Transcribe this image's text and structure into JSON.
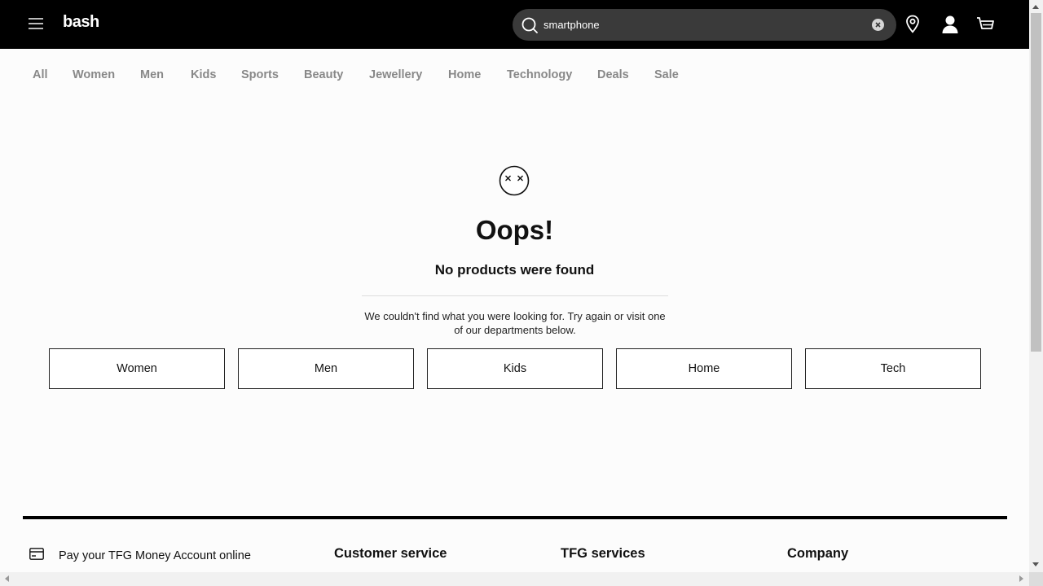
{
  "header": {
    "logo": "bash",
    "search": {
      "value": "smartphone",
      "placeholder": ""
    }
  },
  "nav": {
    "categories": [
      "All",
      "Women",
      "Men",
      "Kids",
      "Sports",
      "Beauty",
      "Jewellery",
      "Home",
      "Technology",
      "Deals",
      "Sale"
    ]
  },
  "empty_state": {
    "title": "Oops!",
    "subtitle": "No products were found",
    "message": "We couldn't find what you were looking for. Try again or visit one of our departments below.",
    "departments": [
      "Women",
      "Men",
      "Kids",
      "Home",
      "Tech"
    ]
  },
  "footer": {
    "pay_link": "Pay your TFG Money Account online",
    "headings": [
      "Customer service",
      "TFG services",
      "Company"
    ]
  }
}
